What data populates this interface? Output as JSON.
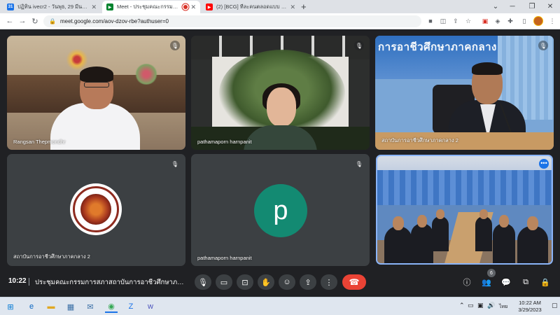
{
  "browser": {
    "tabs": [
      {
        "title": "ปฏิทิน ivecr2 - วันพุธ, 29 มีนาคม 20...",
        "active": false
      },
      {
        "title": "Meet - ประชุมคณะกรรมการสภา...",
        "active": true,
        "recording": true
      },
      {
        "title": "(2) [BCG] ทีละคนตลอดแบบ By Boo...",
        "active": false
      }
    ],
    "new_tab_label": "+",
    "url": "meet.google.com/aov-dzov-rbe?authuser=0"
  },
  "meet": {
    "tiles": [
      {
        "name": "Rangsan Thepmondhr",
        "muted": true
      },
      {
        "name": "pathamaporn harnpanit",
        "muted": true
      },
      {
        "name": "สถาบันการอาชีวศึกษาภาคกลาง 2",
        "muted": true,
        "banner_text": "การอาชีวศึกษาภาคกลาง"
      },
      {
        "name": "สถาบันการอาชีวศึกษาภาคกลาง 2",
        "muted": true
      },
      {
        "name": "pathamaporn harnpanit",
        "muted": true,
        "avatar_letter": "p",
        "avatar_color": "#138a72"
      },
      {
        "name": "",
        "muted": false,
        "highlighted": true
      }
    ],
    "time": "10:22",
    "meeting_title": "ประชุมคณะกรรมการสภาสถาบันการอาชีวศึกษาภาคก...",
    "participant_count": "6",
    "accent_color": "#8ab4f8",
    "end_call_color": "#ea4335"
  },
  "taskbar": {
    "time": "10:22 AM",
    "date": "3/29/2023",
    "language": "ไทย"
  }
}
